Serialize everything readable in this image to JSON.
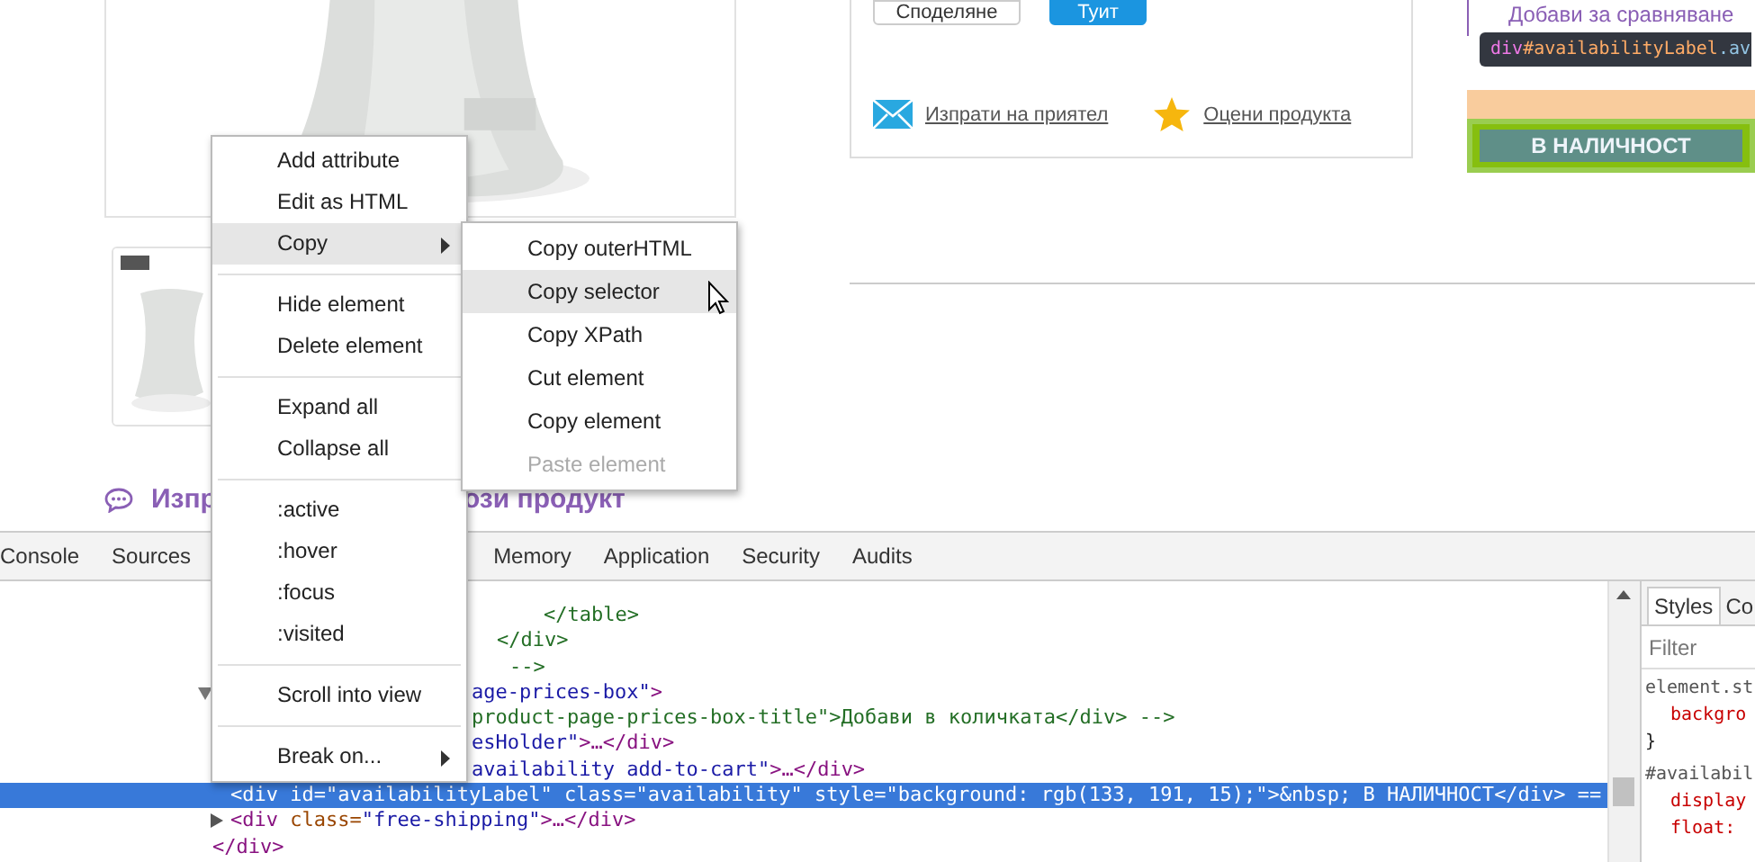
{
  "page": {
    "share_buttons": [
      {
        "label": "Споделяне",
        "kind": "google"
      },
      {
        "label": "Туит",
        "kind": "twitter"
      }
    ],
    "links": [
      {
        "label": "Изпрати на приятел",
        "kind": "mail"
      },
      {
        "label": "Оцени продукта",
        "kind": "star"
      }
    ],
    "compare_link": "Добави за сравняване",
    "availability": "В НАЛИЧНОСТ",
    "heading_parts": [
      "Изпр",
      "ози продукт"
    ]
  },
  "inspector_tooltip": {
    "tag": "div",
    "id": "#availabilityLabel",
    "class": ".av"
  },
  "devtools": {
    "tabs": [
      {
        "label": "Console",
        "selected": false
      },
      {
        "label": "Sources",
        "selected": false
      },
      {
        "label": "Memory",
        "selected": false
      },
      {
        "label": "Application",
        "selected": false
      },
      {
        "label": "Security",
        "selected": false
      },
      {
        "label": "Audits",
        "selected": false
      }
    ],
    "code_lines": [
      {
        "selected": false,
        "segments": [
          {
            "kind": "comment",
            "text": "</table>"
          }
        ]
      },
      {
        "selected": false,
        "segments": [
          {
            "kind": "comment",
            "text": "</div>"
          }
        ]
      },
      {
        "selected": false,
        "segments": [
          {
            "kind": "comment",
            "text": "-->"
          }
        ]
      },
      {
        "expanded": true,
        "selected": false,
        "segments": [
          {
            "kind": "value",
            "text": "age-prices-box\""
          },
          {
            "kind": "tag",
            "text": ">"
          }
        ]
      },
      {
        "selected": false,
        "segments": [
          {
            "kind": "comment",
            "text": "product-page-prices-box-title\">Добави в количката</div> -->"
          }
        ]
      },
      {
        "selected": false,
        "segments": [
          {
            "kind": "value",
            "text": "esHolder\""
          },
          {
            "kind": "tag",
            "text": ">…</div>"
          }
        ]
      },
      {
        "selected": false,
        "segments": [
          {
            "kind": "value",
            "text": "availability add-to-cart\""
          },
          {
            "kind": "tag",
            "text": ">…</div>"
          }
        ]
      },
      {
        "selected": true,
        "segments": [
          {
            "kind": "tag",
            "text": "<div "
          },
          {
            "kind": "attr",
            "text": "id="
          },
          {
            "kind": "value",
            "text": "\"availabilityLabel\" "
          },
          {
            "kind": "attr",
            "text": "class="
          },
          {
            "kind": "value",
            "text": "\"availability\" "
          },
          {
            "kind": "attr",
            "text": "style="
          },
          {
            "kind": "value",
            "text": "\"background: rgb(133, 191, 15);\""
          },
          {
            "kind": "tag",
            "text": ">"
          },
          {
            "kind": "text",
            "text": "&nbsp; В НАЛИЧНОСТ"
          },
          {
            "kind": "tag",
            "text": "</div>"
          },
          {
            "kind": "text",
            "text": " =="
          }
        ]
      },
      {
        "expanded": false,
        "selected": false,
        "segments": [
          {
            "kind": "tag",
            "text": "<div "
          },
          {
            "kind": "attr",
            "text": "class="
          },
          {
            "kind": "value",
            "text": "\"free-shipping\""
          },
          {
            "kind": "tag",
            "text": ">…</div>"
          }
        ]
      },
      {
        "selected": false,
        "segments": [
          {
            "kind": "tag",
            "text": "</div>"
          }
        ]
      }
    ],
    "styles": {
      "tabs": [
        {
          "label": "Styles",
          "selected": true
        },
        {
          "label": "Co",
          "selected": false
        }
      ],
      "filter_placeholder": "Filter",
      "rules": [
        {
          "kind": "selector",
          "text": "element.st"
        },
        {
          "kind": "property",
          "text": "backgro"
        },
        {
          "kind": "brace",
          "text": "}"
        },
        {
          "kind": "selector",
          "text": "#availabil"
        },
        {
          "kind": "property",
          "text": "display"
        },
        {
          "kind": "property",
          "text": "float:"
        }
      ]
    }
  },
  "context_menu": {
    "items": [
      {
        "kind": "item",
        "label": "Add attribute",
        "selected": false,
        "submenu": false
      },
      {
        "kind": "item",
        "label": "Edit as HTML",
        "selected": false,
        "submenu": false
      },
      {
        "kind": "item",
        "label": "Copy",
        "selected": true,
        "submenu": true
      },
      {
        "kind": "separator"
      },
      {
        "kind": "item",
        "label": "Hide element",
        "selected": false,
        "submenu": false
      },
      {
        "kind": "item",
        "label": "Delete element",
        "selected": false,
        "submenu": false
      },
      {
        "kind": "separator"
      },
      {
        "kind": "item",
        "label": "Expand all",
        "selected": false,
        "submenu": false
      },
      {
        "kind": "item",
        "label": "Collapse all",
        "selected": false,
        "submenu": false
      },
      {
        "kind": "separator"
      },
      {
        "kind": "item",
        "label": ":active",
        "selected": false,
        "submenu": false
      },
      {
        "kind": "item",
        "label": ":hover",
        "selected": false,
        "submenu": false
      },
      {
        "kind": "item",
        "label": ":focus",
        "selected": false,
        "submenu": false
      },
      {
        "kind": "item",
        "label": ":visited",
        "selected": false,
        "submenu": false
      },
      {
        "kind": "separator"
      },
      {
        "kind": "item",
        "label": "Scroll into view",
        "selected": false,
        "submenu": false
      },
      {
        "kind": "separator"
      },
      {
        "kind": "item",
        "label": "Break on...",
        "selected": false,
        "submenu": true
      }
    ],
    "submenu": [
      {
        "label": "Copy outerHTML",
        "selected": false,
        "disabled": false
      },
      {
        "label": "Copy selector",
        "selected": true,
        "disabled": false
      },
      {
        "label": "Copy XPath",
        "selected": false,
        "disabled": false
      },
      {
        "label": "Cut element",
        "selected": false,
        "disabled": false
      },
      {
        "label": "Copy element",
        "selected": false,
        "disabled": false
      },
      {
        "label": "Paste element",
        "selected": false,
        "disabled": true
      }
    ]
  }
}
